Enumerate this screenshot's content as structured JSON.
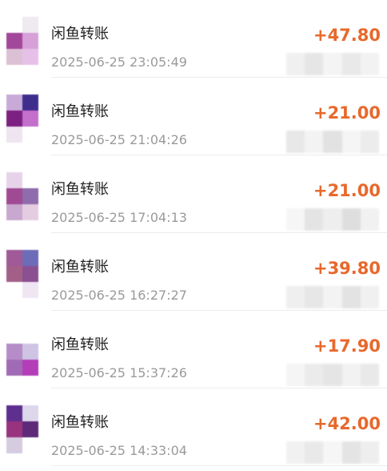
{
  "colors": {
    "amount": "#e8682b",
    "title": "#222222",
    "time": "#9a9a9a",
    "divider": "#ececec"
  },
  "icons": {
    "avatar": "avatar-icon"
  },
  "transactions": [
    {
      "title": "闲鱼转账",
      "time": "2025-06-25 23:05:49",
      "amount": "+47.80",
      "avatar_colors": [
        "#ffffff",
        "#eeeaf0",
        "#a2479a",
        "#d7a0d8",
        "#dcc0d4",
        "#e7c0e8"
      ]
    },
    {
      "title": "闲鱼转账",
      "time": "2025-06-25 21:04:26",
      "amount": "+21.00",
      "avatar_colors": [
        "#c8aad8",
        "#3f2d8e",
        "#7c2082",
        "#c36fcb",
        "#eee5f0",
        "#ffffff"
      ]
    },
    {
      "title": "闲鱼转账",
      "time": "2025-06-25 17:04:13",
      "amount": "+21.00",
      "avatar_colors": [
        "#e6d3ea",
        "#ffffff",
        "#a04a93",
        "#8f6cae",
        "#c9a8cf",
        "#e5cde1"
      ]
    },
    {
      "title": "闲鱼转账",
      "time": "2025-06-25 16:27:27",
      "amount": "+39.80",
      "avatar_colors": [
        "#a05a98",
        "#6d6cb8",
        "#a26089",
        "#8a5092",
        "#ffffff",
        "#efe5f3"
      ]
    },
    {
      "title": "闲鱼转账",
      "time": "2025-06-25 15:37:26",
      "amount": "+17.90",
      "avatar_colors": [
        "#ffffff",
        "#ffffff",
        "#b58cc8",
        "#cfc4e4",
        "#a16ab5",
        "#b43db8"
      ]
    },
    {
      "title": "闲鱼转账",
      "time": "2025-06-25 14:33:04",
      "amount": "+42.00",
      "avatar_colors": [
        "#5e2f8f",
        "#ddd7ec",
        "#98347f",
        "#5e2978",
        "#d6cce0",
        "#ffffff"
      ]
    }
  ]
}
